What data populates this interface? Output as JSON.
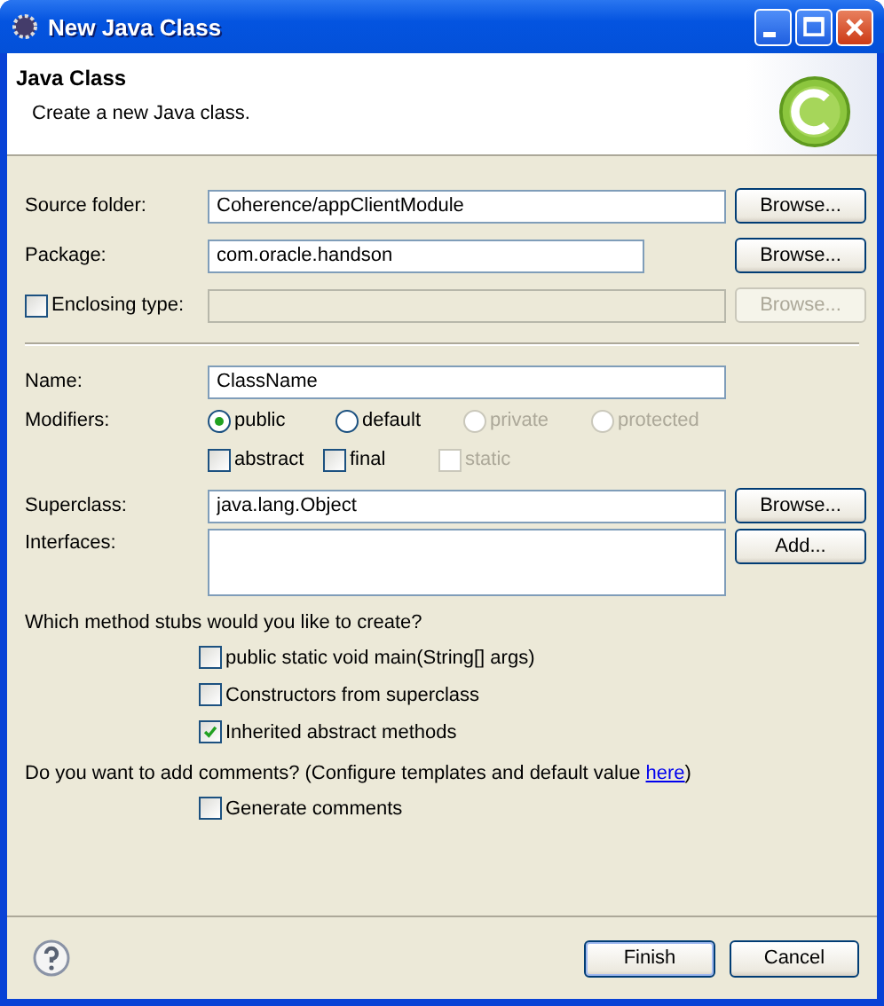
{
  "window": {
    "title": "New Java Class"
  },
  "header": {
    "title": "Java Class",
    "description": "Create a new Java class."
  },
  "source_folder": {
    "label": "Source folder:",
    "value": "Coherence/appClientModule",
    "button": {
      "label": "Browse...",
      "disabled": false
    }
  },
  "package": {
    "label": "Package:",
    "value": "com.oracle.handson",
    "button": {
      "label": "Browse...",
      "disabled": false
    }
  },
  "enclosing_type": {
    "label": "Enclosing type:",
    "checked": false,
    "field_disabled": true,
    "button": {
      "label": "Browse...",
      "disabled": true
    }
  },
  "name": {
    "label": "Name:",
    "value": "ClassName"
  },
  "modifiers": {
    "label": "Modifiers:",
    "access": [
      {
        "label": "public",
        "selected": true,
        "disabled": false
      },
      {
        "label": "default",
        "selected": false,
        "disabled": false
      },
      {
        "label": "private",
        "selected": false,
        "disabled": true
      },
      {
        "label": "protected",
        "selected": false,
        "disabled": true
      }
    ],
    "flags": [
      {
        "label": "abstract",
        "checked": false,
        "disabled": false
      },
      {
        "label": "final",
        "checked": false,
        "disabled": false
      },
      {
        "label": "static",
        "checked": false,
        "disabled": true
      }
    ]
  },
  "superclass": {
    "label": "Superclass:",
    "value": "java.lang.Object",
    "button": {
      "label": "Browse...",
      "disabled": false
    }
  },
  "interfaces": {
    "label": "Interfaces:",
    "button": {
      "label": "Add...",
      "disabled": false
    }
  },
  "stubs": {
    "question": "Which method stubs would you like to create?",
    "options": [
      {
        "label": "public static void main(String[] args)",
        "checked": false
      },
      {
        "label": "Constructors from superclass",
        "checked": false
      },
      {
        "label": "Inherited abstract methods",
        "checked": true
      }
    ]
  },
  "comments": {
    "question": "Do you want to add comments? (Configure templates and default value",
    "link": "here",
    "closing": ")",
    "option": {
      "label": "Generate comments",
      "checked": false
    }
  },
  "footer": {
    "buttons": [
      {
        "label": "Finish",
        "default": true
      },
      {
        "label": "Cancel",
        "default": false
      }
    ]
  }
}
